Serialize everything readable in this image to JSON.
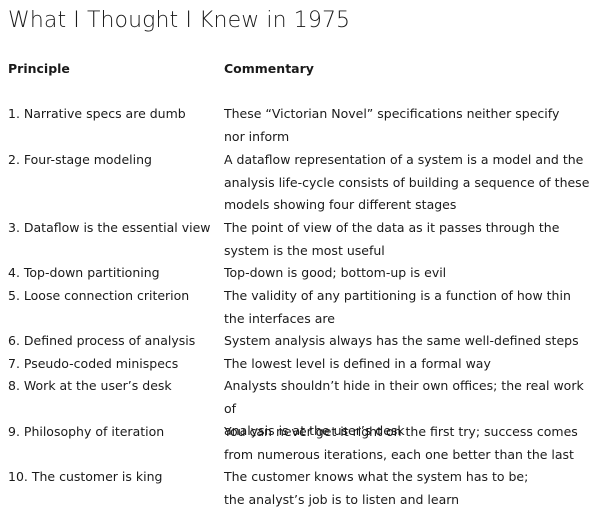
{
  "title": "What I Thought I Knew in 1975",
  "headers": {
    "principle": "Principle",
    "commentary": "Commentary"
  },
  "rows": [
    {
      "principle": "1. Narrative specs are dumb",
      "commentary": "These “Victorian Novel” specifications neither specify\n nor inform"
    },
    {
      "principle": "2. Four-stage modeling",
      "commentary": "A dataflow representation of a system is a model and the\nanalysis life-cycle consists  of building a sequence of these\nmodels showing four different stages"
    },
    {
      "principle": "3. Dataflow is the essential view",
      "commentary": "The point of view of the data as it passes through the\nsystem is the most useful"
    },
    {
      "principle": "4. Top-down partitioning",
      "commentary": "Top-down is good; bottom-up is evil"
    },
    {
      "principle": "5. Loose connection criterion",
      "commentary": "The validity of any partitioning is a function of how thin\nthe interfaces are"
    },
    {
      "principle": "6. Defined process of analysis",
      "commentary": "System analysis always has the same well-defined steps"
    },
    {
      "principle": "7. Pseudo-coded minispecs",
      "commentary": "The lowest level is defined in a formal way"
    },
    {
      "principle": "8. Work at the user’s desk",
      "commentary": "Analysts shouldn’t hide in their own offices; the real work of\nanalysis is at the user’s desk"
    },
    {
      "principle": "9. Philosophy of iteration",
      "commentary": "You can never get it right on the first try; success comes\nfrom numerous iterations, each one better than the last"
    },
    {
      "principle": "10. The customer is king",
      "commentary": "The customer knows what the system has to be;\nthe analyst’s job is to listen and learn"
    }
  ]
}
